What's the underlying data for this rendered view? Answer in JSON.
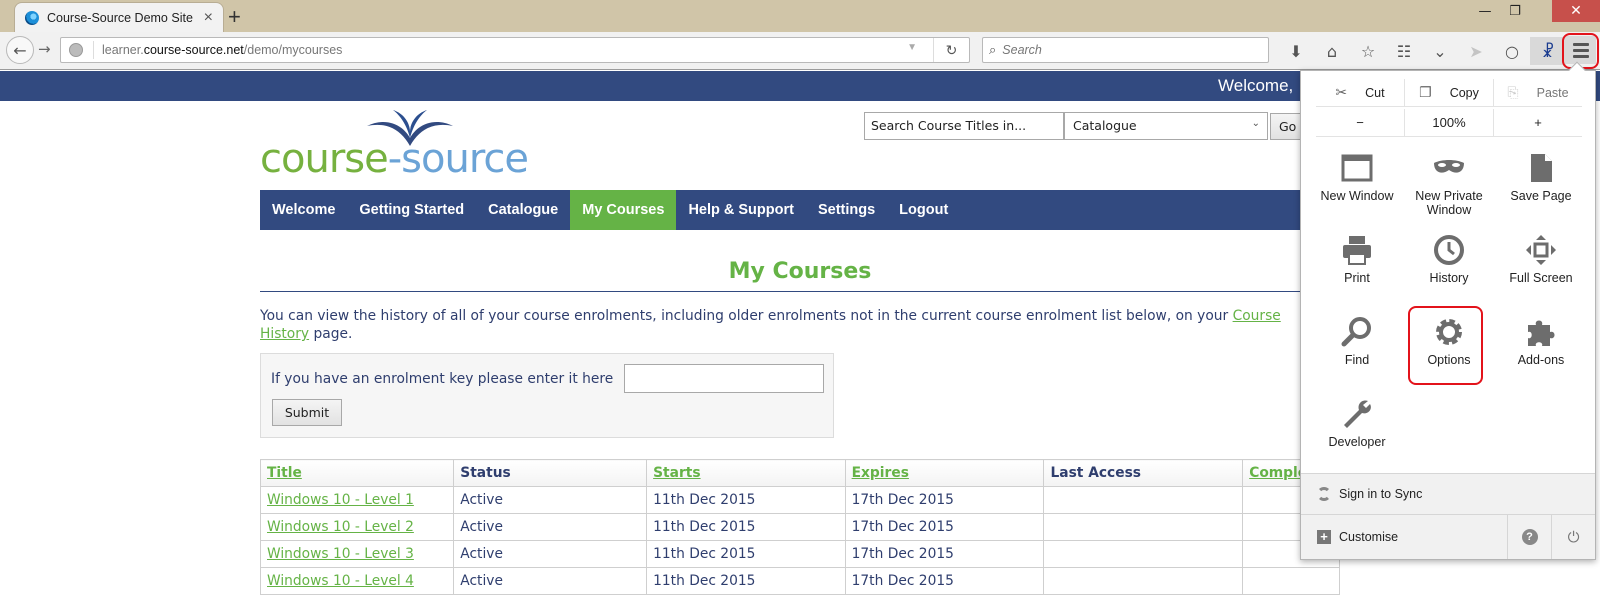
{
  "browser": {
    "tab_title": "Course-Source Demo Site",
    "tab_close": "×",
    "new_tab": "+",
    "url_prefix": "learner.",
    "url_host": "course-source.net",
    "url_path": "/demo/mycourses",
    "search_placeholder": "Search",
    "window_controls": {
      "minimize": "—",
      "maximize": "❐",
      "close": "✕"
    },
    "toolbar_icons": [
      "download-icon",
      "home-icon",
      "bookmark-star-icon",
      "reading-list-icon",
      "pocket-icon",
      "send-icon",
      "chat-icon",
      "extension-icon",
      "hamburger-menu-icon"
    ]
  },
  "menu_panel": {
    "edit": {
      "cut": "Cut",
      "copy": "Copy",
      "paste": "Paste"
    },
    "zoom": {
      "minus": "−",
      "level": "100%",
      "plus": "+"
    },
    "items": [
      {
        "label": "New Window",
        "icon": "new-window-icon"
      },
      {
        "label": "New Private Window",
        "icon": "private-mask-icon"
      },
      {
        "label": "Save Page",
        "icon": "save-page-icon"
      },
      {
        "label": "Print",
        "icon": "print-icon"
      },
      {
        "label": "History",
        "icon": "history-clock-icon"
      },
      {
        "label": "Full Screen",
        "icon": "full-screen-icon"
      },
      {
        "label": "Find",
        "icon": "find-magnifier-icon"
      },
      {
        "label": "Options",
        "icon": "options-gear-icon",
        "highlighted": true
      },
      {
        "label": "Add-ons",
        "icon": "addons-puzzle-icon"
      },
      {
        "label": "Developer",
        "icon": "developer-wrench-icon"
      }
    ],
    "sign_in": "Sign in to Sync",
    "customise": "Customise",
    "help": "?",
    "quit": "⏻"
  },
  "site": {
    "welcome": "Welcome,",
    "logo": {
      "part1": "course",
      "dash": "-",
      "part2": "source"
    },
    "search_placeholder": "Search Course Titles in...",
    "search_scope": "Catalogue",
    "go_label": "Go",
    "nav": [
      {
        "label": "Welcome",
        "active": false
      },
      {
        "label": "Getting Started",
        "active": false
      },
      {
        "label": "Catalogue",
        "active": false
      },
      {
        "label": "My Courses",
        "active": true
      },
      {
        "label": "Help & Support",
        "active": false
      },
      {
        "label": "Settings",
        "active": false
      },
      {
        "label": "Logout",
        "active": false
      }
    ],
    "page_title": "My Courses",
    "intro_text": "You can view the history of all of your course enrolments, including older enrolments not in the current course enrolment list below, on your ",
    "intro_link": "Course History",
    "intro_end": " page.",
    "enrol_label": "If you have an enrolment key please enter it here",
    "enrol_value": "",
    "submit_label": "Submit",
    "table": {
      "headers": [
        "Title",
        "Status",
        "Starts",
        "Expires",
        "Last Access",
        "Completed"
      ],
      "rows": [
        {
          "title": "Windows 10 - Level 1",
          "status": "Active",
          "starts": "11th Dec 2015",
          "expires": "17th Dec 2015",
          "last_access": "",
          "completed": ""
        },
        {
          "title": "Windows 10 - Level 2",
          "status": "Active",
          "starts": "11th Dec 2015",
          "expires": "17th Dec 2015",
          "last_access": "",
          "completed": ""
        },
        {
          "title": "Windows 10 - Level 3",
          "status": "Active",
          "starts": "11th Dec 2015",
          "expires": "17th Dec 2015",
          "last_access": "",
          "completed": ""
        },
        {
          "title": "Windows 10 - Level 4",
          "status": "Active",
          "starts": "11th Dec 2015",
          "expires": "17th Dec 2015",
          "last_access": "",
          "completed": ""
        }
      ]
    }
  },
  "colors": {
    "brand_blue": "#324a80",
    "brand_green": "#65b346",
    "highlight_red": "#e3131b"
  }
}
